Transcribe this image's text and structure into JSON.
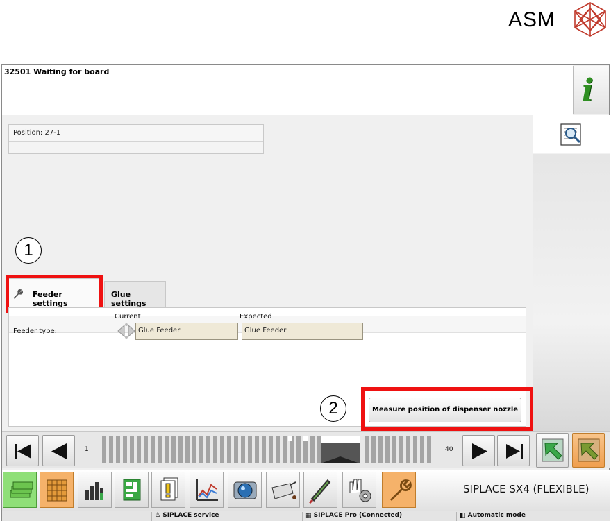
{
  "brand": {
    "name": "ASM"
  },
  "message_bar": {
    "text": "32501 Waiting for board"
  },
  "position": {
    "text": "Position: 27-1"
  },
  "callouts": {
    "one": "1",
    "two": "2"
  },
  "tabs": [
    {
      "label": "Feeder settings",
      "active": true,
      "icon": "wrench-icon"
    },
    {
      "label": "Glue settings",
      "active": false
    }
  ],
  "feeder": {
    "type_label": "Feeder type:",
    "current_header": "Current",
    "expected_header": "Expected",
    "current_value": "Glue Feeder",
    "expected_value": "Glue Feeder"
  },
  "measure_button": {
    "label": "Measure position of dispenser nozzle"
  },
  "navigation": {
    "first_index": "1",
    "last_index": "40"
  },
  "machine": {
    "name": "SIPLACE SX4 (FLEXIBLE)"
  },
  "status_bar": {
    "service": "SIPLACE service",
    "pro": "SIPLACE Pro (Connected)",
    "mode": "Automatic mode"
  },
  "colors": {
    "highlight_red": "#ef1111",
    "active_orange": "#f5b26a",
    "field_beige": "#efe9d7",
    "info_green": "#2f8f22"
  }
}
